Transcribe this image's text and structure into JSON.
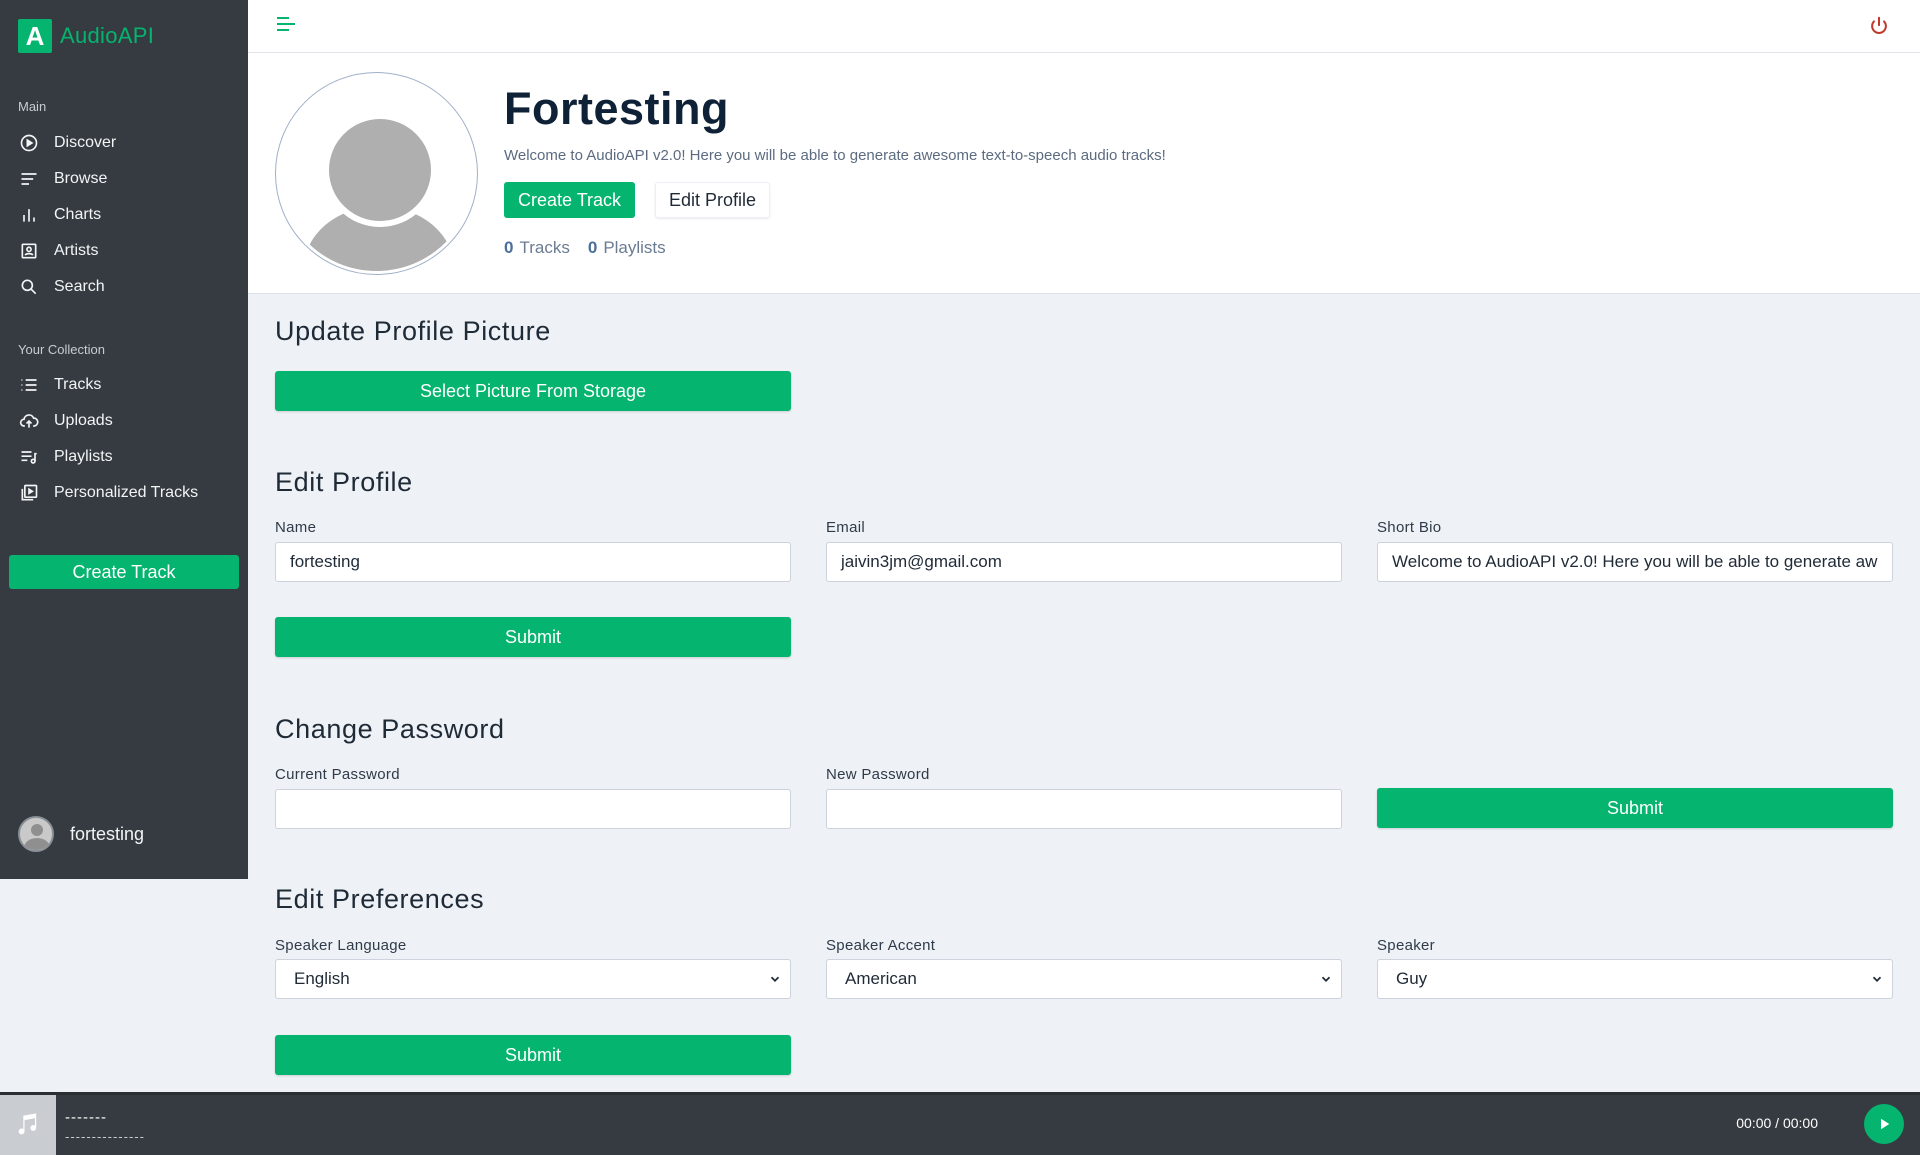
{
  "brand": {
    "logo_letter": "A",
    "name": "AudioAPI",
    "accent": "#05b46e"
  },
  "sidebar": {
    "main_heading": "Main",
    "main_items": [
      {
        "label": "Discover",
        "icon": "play-circle-icon"
      },
      {
        "label": "Browse",
        "icon": "browse-lines-icon"
      },
      {
        "label": "Charts",
        "icon": "bar-chart-icon"
      },
      {
        "label": "Artists",
        "icon": "artist-portrait-icon"
      },
      {
        "label": "Search",
        "icon": "search-icon"
      }
    ],
    "collection_heading": "Your Collection",
    "collection_items": [
      {
        "label": "Tracks",
        "icon": "list-icon"
      },
      {
        "label": "Uploads",
        "icon": "cloud-upload-icon"
      },
      {
        "label": "Playlists",
        "icon": "playlist-icon"
      },
      {
        "label": "Personalized Tracks",
        "icon": "video-library-icon"
      }
    ],
    "create_label": "Create Track",
    "username": "fortesting"
  },
  "topbar": {
    "menu_icon": "hamburger-menu-icon",
    "power_icon": "power-icon",
    "power_color": "#c0392b"
  },
  "profile": {
    "name": "Fortesting",
    "bio": "Welcome to AudioAPI v2.0! Here you will be able to generate awesome text-to-speech audio tracks!",
    "create_label": "Create Track",
    "edit_label": "Edit Profile",
    "tracks_count": "0",
    "tracks_label": "Tracks",
    "playlists_count": "0",
    "playlists_label": "Playlists"
  },
  "update_picture": {
    "title": "Update Profile Picture",
    "button": "Select Picture From Storage"
  },
  "edit_profile": {
    "title": "Edit Profile",
    "name_label": "Name",
    "name_value": "fortesting",
    "email_label": "Email",
    "email_value": "jaivin3jm@gmail.com",
    "bio_label": "Short Bio",
    "bio_value": "Welcome to AudioAPI v2.0! Here you will be able to generate aw",
    "submit": "Submit"
  },
  "change_password": {
    "title": "Change Password",
    "current_label": "Current Password",
    "current_value": "",
    "new_label": "New Password",
    "new_value": "",
    "submit": "Submit"
  },
  "preferences": {
    "title": "Edit Preferences",
    "language_label": "Speaker Language",
    "language_value": "English",
    "accent_label": "Speaker Accent",
    "accent_value": "American",
    "speaker_label": "Speaker",
    "speaker_value": "Guy",
    "submit": "Submit"
  },
  "player": {
    "art_icon": "music-note-icon",
    "title": "-------",
    "artist": "---------------",
    "time": "00:00 / 00:00",
    "play_icon": "play-icon"
  }
}
